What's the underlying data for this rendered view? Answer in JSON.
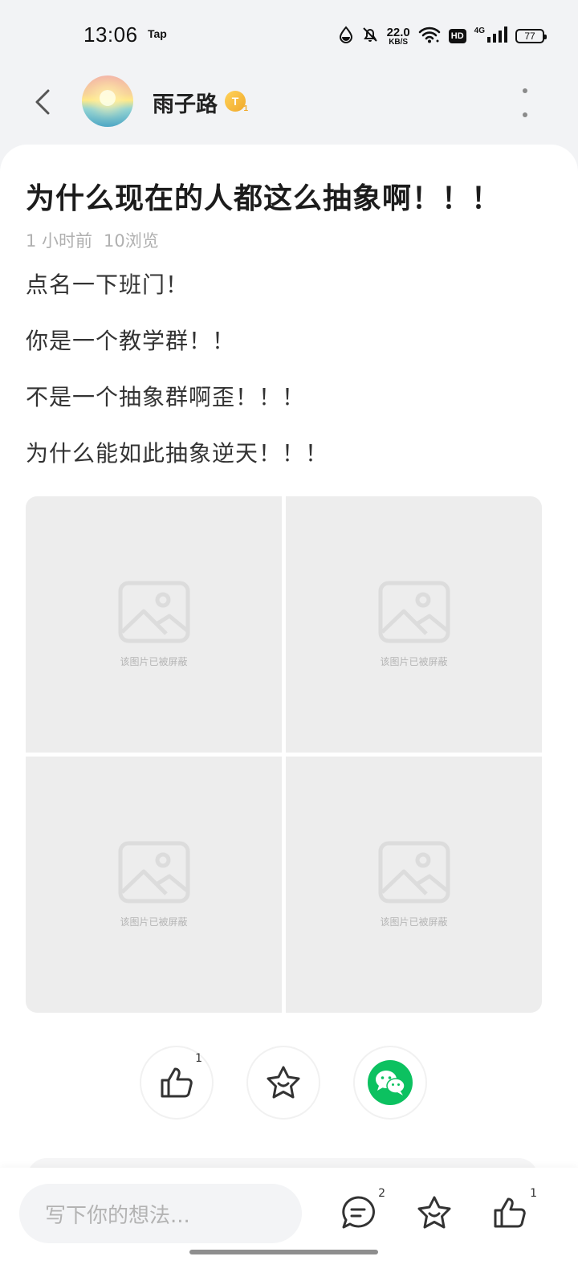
{
  "status_bar": {
    "time": "13:06",
    "app_label": "Tap",
    "net_speed_value": "22.0",
    "net_speed_unit": "KB/S",
    "hd_label": "HD",
    "network_type": "4G",
    "battery": "77"
  },
  "header": {
    "username": "雨子路",
    "badge_letter": "T"
  },
  "post": {
    "title": "为什么现在的人都这么抽象啊！！！",
    "time_ago": "1 小时前",
    "views": "10浏览",
    "lines": [
      "点名一下班门！",
      "你是一个教学群！！",
      "不是一个抽象群啊歪！！！",
      "为什么能如此抽象逆天！！！"
    ],
    "images": [
      {
        "placeholder": "该图片已被屏蔽"
      },
      {
        "placeholder": "该图片已被屏蔽"
      },
      {
        "placeholder": "该图片已被屏蔽"
      },
      {
        "placeholder": "该图片已被屏蔽"
      }
    ]
  },
  "actions": {
    "like_count": "1",
    "share_wechat_icon": "wechat-icon",
    "favorite_icon": "star-icon",
    "like_icon": "thumbs-up-icon"
  },
  "bottom_bar": {
    "comment_placeholder": "写下你的想法...",
    "comment_count": "2",
    "like_count": "1"
  },
  "colors": {
    "wechat_green": "#0cc160",
    "badge_gold": "#f0a82a",
    "meta_gray": "#b0b0b0"
  }
}
